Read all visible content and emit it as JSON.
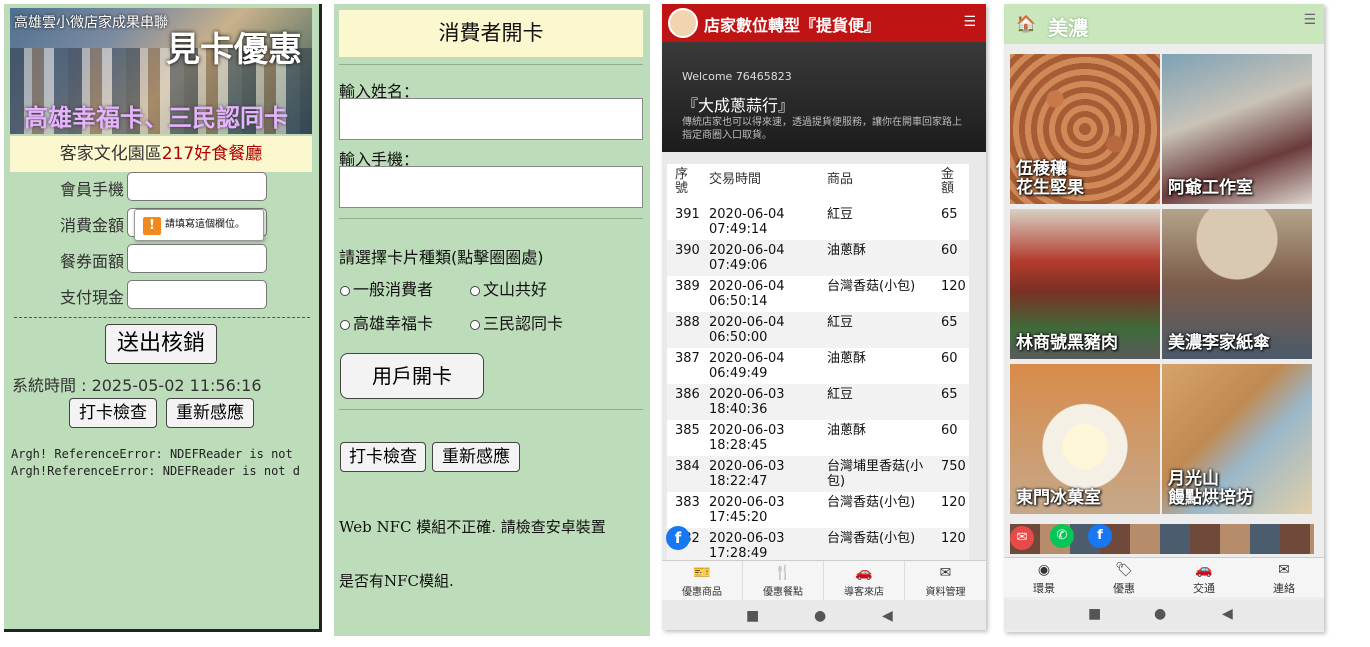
{
  "panel1": {
    "banner_top": "高雄雲小微店家成果串聯",
    "banner_big": "見卡優惠",
    "banner_sub": "高雄幸福卡、三民認同卡",
    "subtitle_prefix": "客家文化園區",
    "subtitle_highlight": "217好食餐廳",
    "fields": [
      {
        "label": "會員手機",
        "value": ""
      },
      {
        "label": "消費金額",
        "value": ""
      },
      {
        "label": "餐券面額",
        "value": ""
      },
      {
        "label": "支付現金",
        "value": ""
      }
    ],
    "tooltip": "請填寫這個欄位。",
    "submit_label": "送出核銷",
    "system_time": "系統時間 : 2025-05-02 11:56:16",
    "check_label": "打卡檢查",
    "rescan_label": "重新感應",
    "error1": "Argh! ReferenceError: NDEFReader is not",
    "error2": "Argh!ReferenceError: NDEFReader is not d"
  },
  "panel2": {
    "title": "消費者開卡",
    "name_label": "輸入姓名：",
    "phone_label": "輸入手機：",
    "card_type_label": "請選擇卡片種類(點擊圈圈處)",
    "options": [
      "一般消費者",
      "文山共好",
      "高雄幸福卡",
      "三民認同卡"
    ],
    "open_label": "用戶開卡",
    "check_label": "打卡檢查",
    "rescan_label": "重新感應",
    "nfc_msg1": "Web NFC 模組不正確. 請檢查安卓裝置",
    "nfc_msg2": "是否有NFC模組."
  },
  "panel3": {
    "header_title": "店家數位轉型『提貨便』",
    "welcome": "Welcome 76465823",
    "shop": "『大成蔥蒜行』",
    "desc": "傳統店家也可以得來速，透過提貨便服務，讓你在開車回家路上指定商圈入口取貨。",
    "columns": [
      "序號",
      "交易時間",
      "商品",
      "金額"
    ],
    "rows": [
      {
        "id": "391",
        "date": "2020-06-04",
        "time": "07:49:14",
        "item": "紅豆",
        "amount": "65"
      },
      {
        "id": "390",
        "date": "2020-06-04",
        "time": "07:49:06",
        "item": "油蔥酥",
        "amount": "60"
      },
      {
        "id": "389",
        "date": "2020-06-04",
        "time": "06:50:14",
        "item": "台灣香菇(小包)",
        "amount": "120"
      },
      {
        "id": "388",
        "date": "2020-06-04",
        "time": "06:50:00",
        "item": "紅豆",
        "amount": "65"
      },
      {
        "id": "387",
        "date": "2020-06-04",
        "time": "06:49:49",
        "item": "油蔥酥",
        "amount": "60"
      },
      {
        "id": "386",
        "date": "2020-06-03",
        "time": "18:40:36",
        "item": "紅豆",
        "amount": "65"
      },
      {
        "id": "385",
        "date": "2020-06-03",
        "time": "18:28:45",
        "item": "油蔥酥",
        "amount": "60"
      },
      {
        "id": "384",
        "date": "2020-06-03",
        "time": "18:22:47",
        "item": "台灣埔里香菇(小包)",
        "amount": "750"
      },
      {
        "id": "383",
        "date": "2020-06-03",
        "time": "17:45:20",
        "item": "台灣香菇(小包)",
        "amount": "120"
      },
      {
        "id": "382",
        "date": "2020-06-03",
        "time": "17:28:49",
        "item": "台灣香菇(小包)",
        "amount": "120"
      }
    ],
    "tabs": [
      "優惠商品",
      "優惠餐點",
      "導客來店",
      "資料管理"
    ]
  },
  "panel4": {
    "header_title": "美濃",
    "tiles": [
      "伍稜穰\n花生堅果",
      "阿爺工作室",
      "林商號黑豬肉",
      "美濃李家紙傘",
      "東門冰菓室",
      "月光山\n饅點烘培坊"
    ],
    "tabs": [
      "環景",
      "優惠",
      "交通",
      "連絡"
    ]
  }
}
